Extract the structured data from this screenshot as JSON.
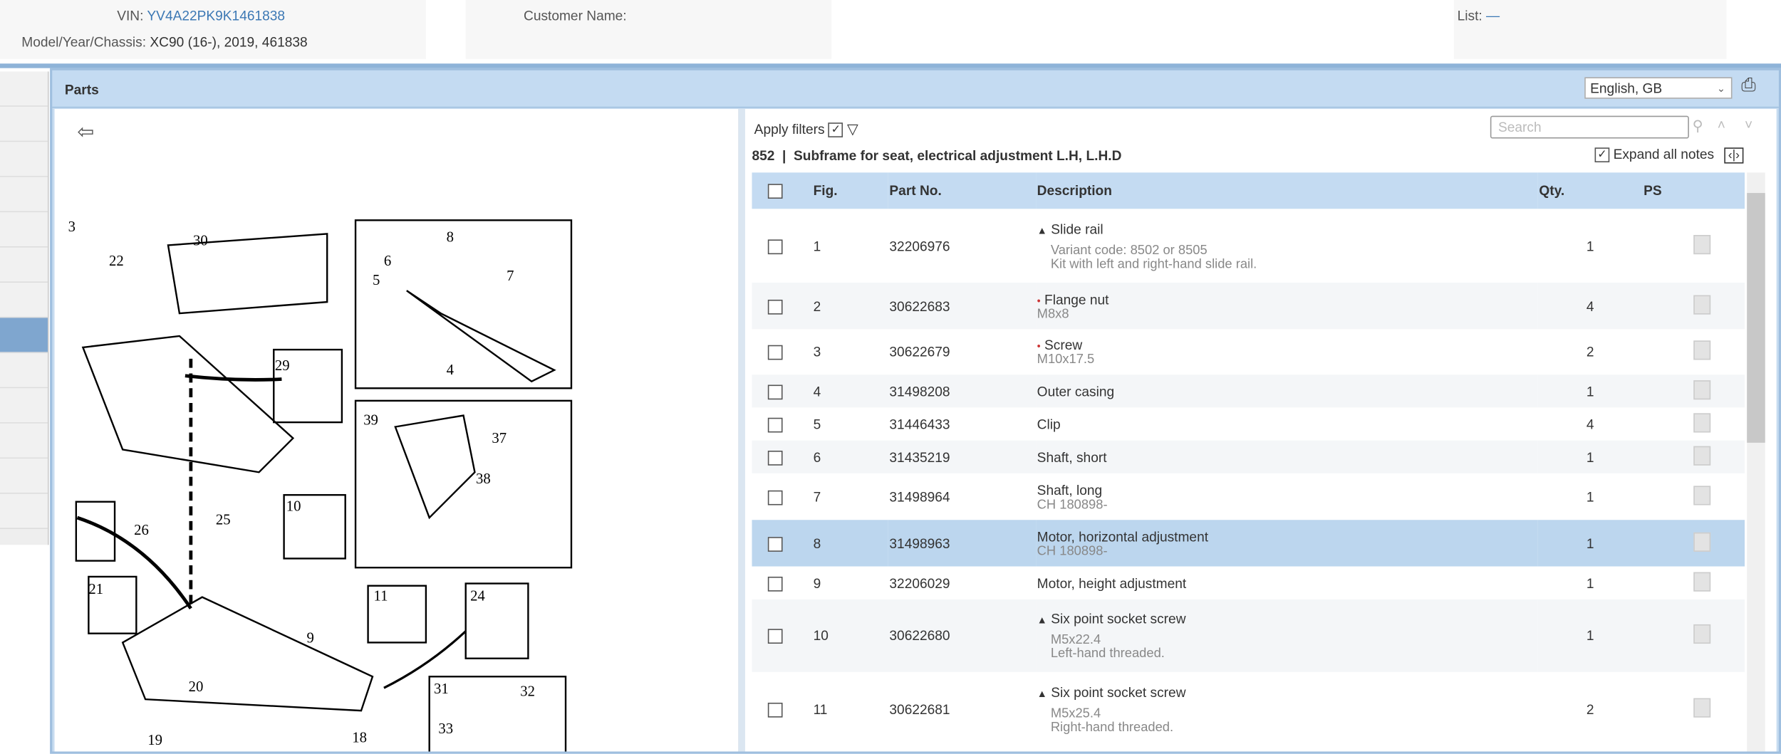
{
  "header": {
    "vin_label": "VIN:",
    "vin": "YV4A22PK9K1461838",
    "model_label": "Model/Year/Chassis:",
    "model": "XC90 (16-), 2019, 461838",
    "customer_label": "Customer Name:",
    "list_label": "List:",
    "list_value": "—"
  },
  "panel": {
    "title": "Parts",
    "language": "English, GB"
  },
  "toolbar": {
    "apply_filters": "Apply filters",
    "search_placeholder": "Search",
    "expand_notes": "Expand all notes",
    "group_title": "852  |  Subframe for seat, electrical adjustment L.H, L.H.D"
  },
  "table": {
    "headers": {
      "fig": "Fig.",
      "part": "Part No.",
      "desc": "Description",
      "qty": "Qty.",
      "ps": "PS"
    },
    "rows": [
      {
        "fig": "1",
        "part": "32206976",
        "desc": "Slide rail",
        "marker": "▲",
        "notes": [
          "Variant code: 8502 or 8505",
          "Kit with left and right-hand slide rail."
        ],
        "qty": "1"
      },
      {
        "fig": "2",
        "part": "30622683",
        "desc": "Flange nut",
        "marker": "•",
        "notes": [
          "M8x8"
        ],
        "qty": "4"
      },
      {
        "fig": "3",
        "part": "30622679",
        "desc": "Screw",
        "marker": "•",
        "notes": [
          "M10x17.5"
        ],
        "qty": "2"
      },
      {
        "fig": "4",
        "part": "31498208",
        "desc": "Outer casing",
        "marker": "",
        "notes": [],
        "qty": "1"
      },
      {
        "fig": "5",
        "part": "31446433",
        "desc": "Clip",
        "marker": "",
        "notes": [],
        "qty": "4"
      },
      {
        "fig": "6",
        "part": "31435219",
        "desc": "Shaft, short",
        "marker": "",
        "notes": [],
        "qty": "1"
      },
      {
        "fig": "7",
        "part": "31498964",
        "desc": "Shaft, long",
        "marker": "",
        "notes": [
          "CH 180898-"
        ],
        "qty": "1"
      },
      {
        "fig": "8",
        "part": "31498963",
        "desc": "Motor, horizontal adjustment",
        "marker": "",
        "notes": [
          "CH 180898-"
        ],
        "qty": "1",
        "selected": true
      },
      {
        "fig": "9",
        "part": "32206029",
        "desc": "Motor, height adjustment",
        "marker": "",
        "notes": [],
        "qty": "1"
      },
      {
        "fig": "10",
        "part": "30622680",
        "desc": "Six point socket screw",
        "marker": "▲",
        "notes": [
          "M5x22.4",
          "Left-hand threaded."
        ],
        "qty": "1"
      },
      {
        "fig": "11",
        "part": "30622681",
        "desc": "Six point socket screw",
        "marker": "▲",
        "notes": [
          "M5x25.4",
          "Right-hand threaded."
        ],
        "qty": "2"
      }
    ]
  },
  "diagram": {
    "labels": [
      "3",
      "22",
      "30",
      "29",
      "26",
      "25",
      "10",
      "21",
      "20",
      "19",
      "18",
      "9",
      "11",
      "24",
      "6",
      "5",
      "8",
      "7",
      "4",
      "39",
      "37",
      "38",
      "31",
      "32",
      "33"
    ]
  }
}
